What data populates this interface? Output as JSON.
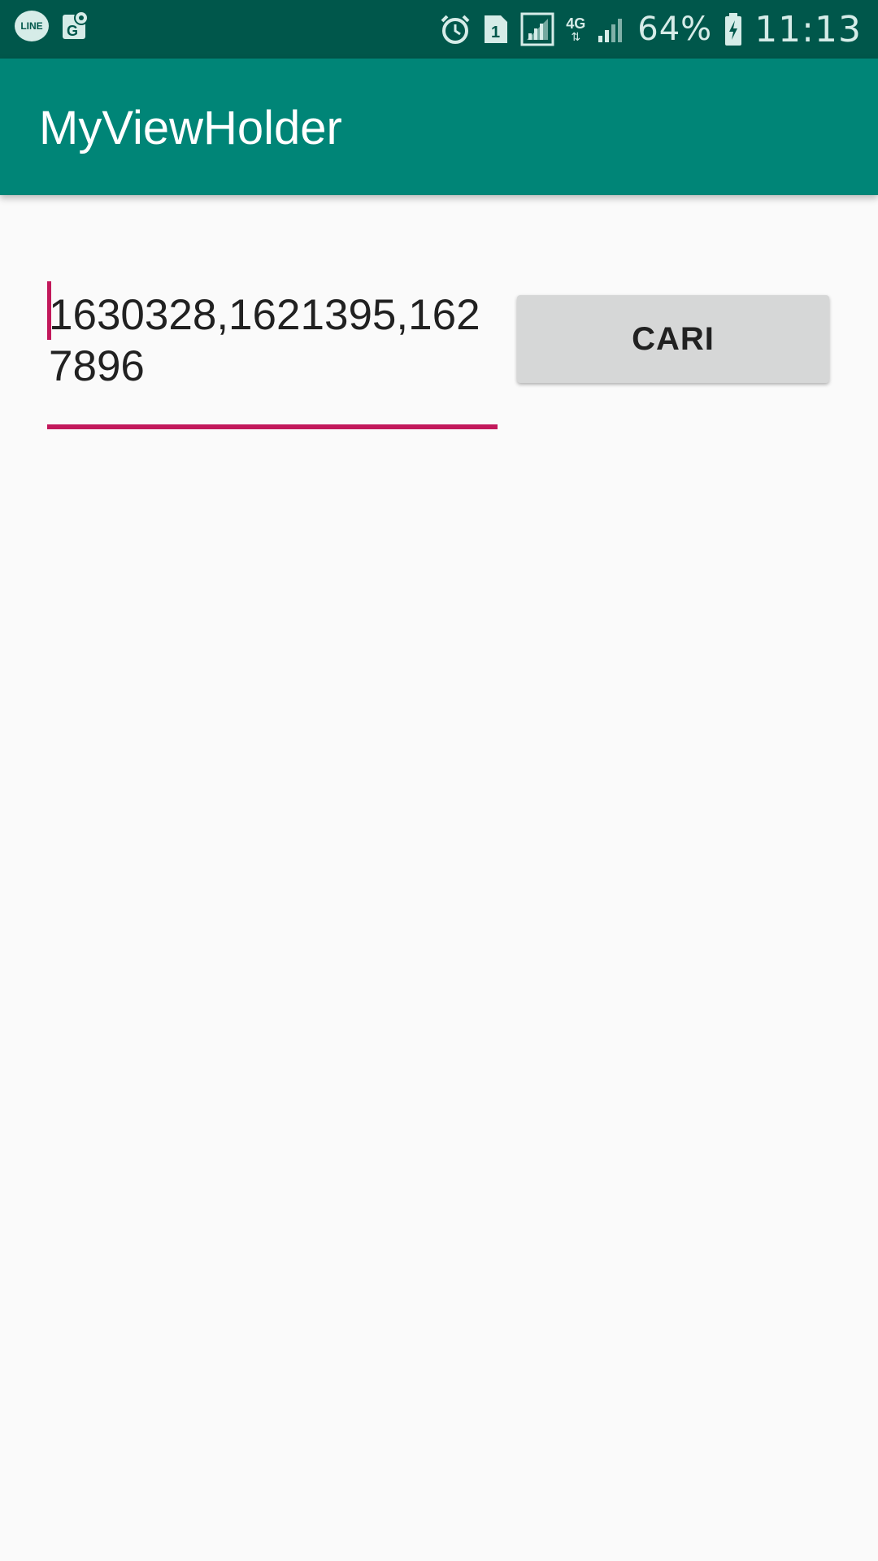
{
  "status_bar": {
    "left_icons": [
      "line-icon",
      "google-maps-icon"
    ],
    "line_label": "LINE",
    "right_icons": [
      "alarm-icon",
      "sim-1-icon",
      "signal-icon",
      "4g-icon",
      "signal-icon-2",
      "battery-charging-icon"
    ],
    "sim_label": "1",
    "network_label": "4G",
    "battery_percent": "64%",
    "time": "11:13"
  },
  "app_bar": {
    "title": "MyViewHolder"
  },
  "search": {
    "value": "1630328,1621395,1627896"
  },
  "cari_button": {
    "label": "CARI"
  },
  "colors": {
    "status_bar": "#00574b",
    "app_bar": "#008577",
    "accent": "#c2185b",
    "button": "#d6d7d7",
    "background": "#fafafa"
  }
}
